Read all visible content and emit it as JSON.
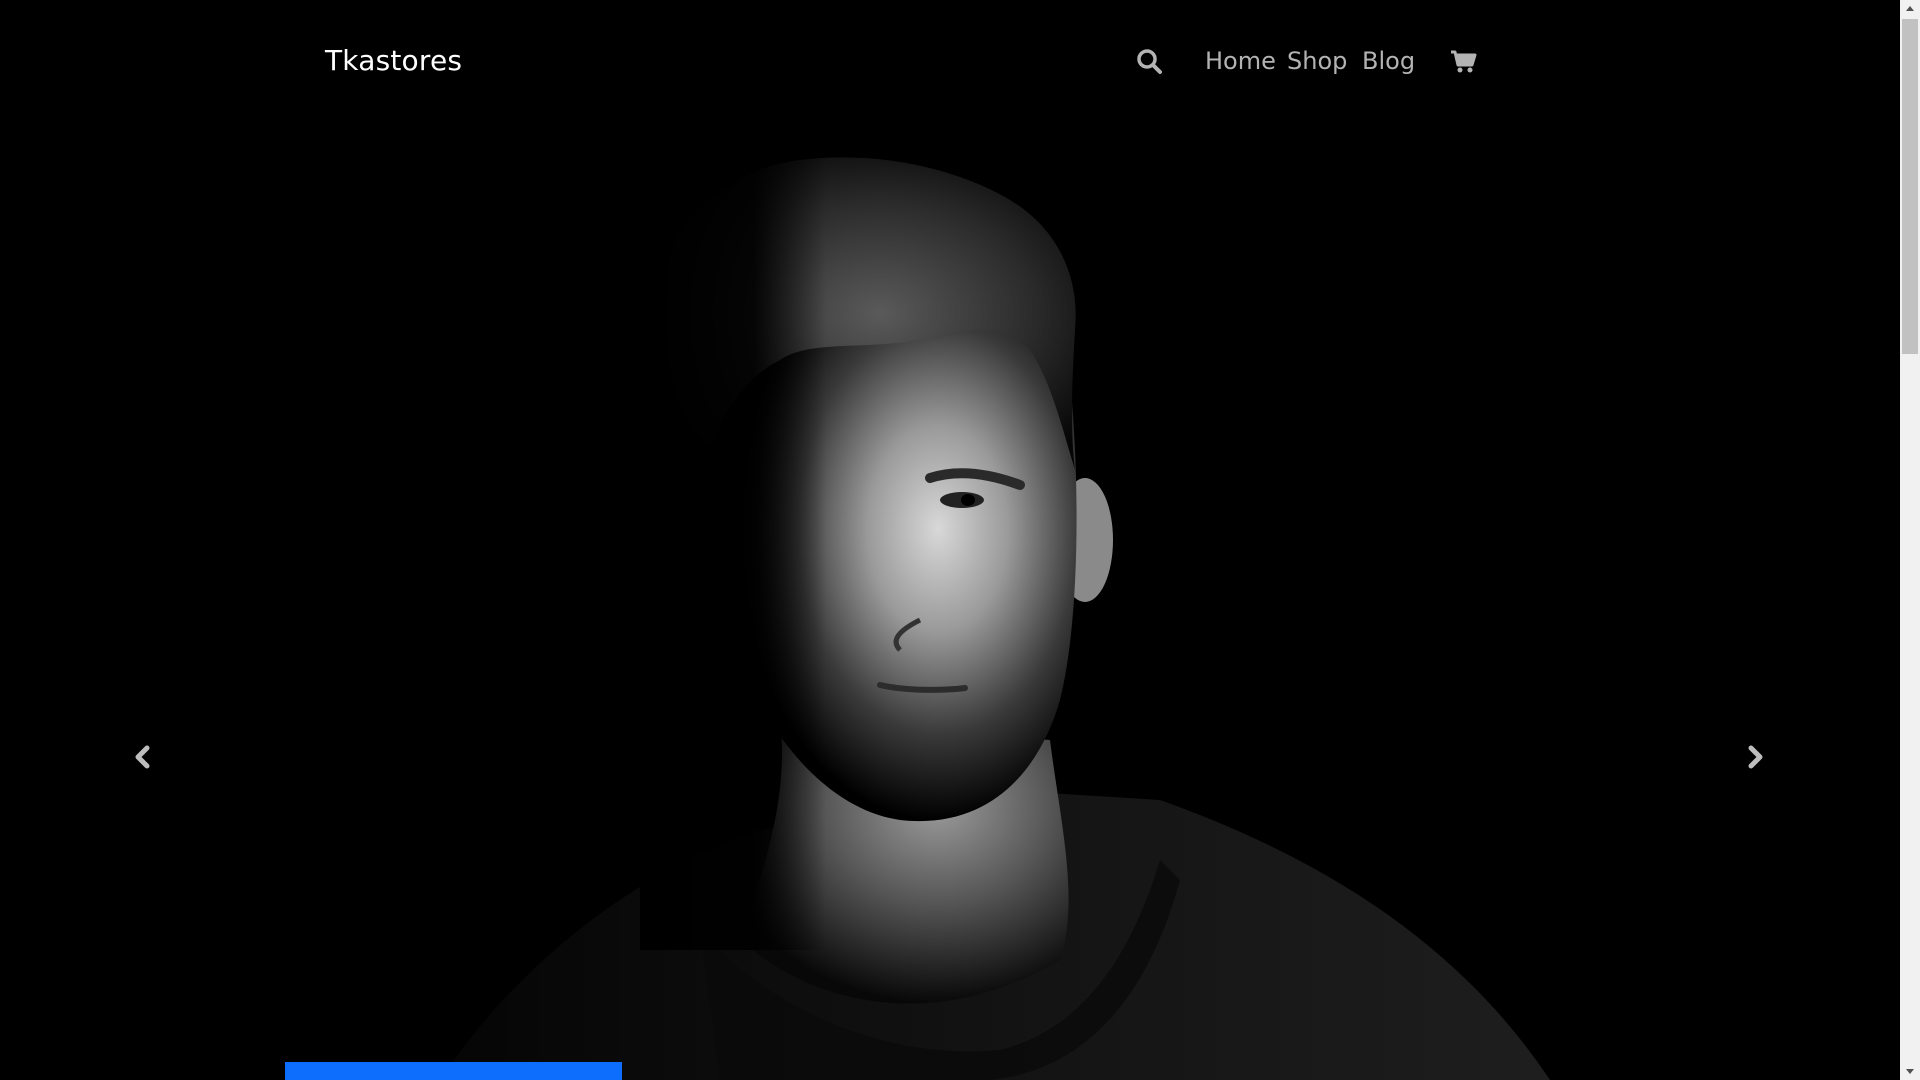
{
  "navbar": {
    "brand": "Tkastores",
    "links": [
      "Home",
      "Shop",
      "Blog"
    ],
    "search_icon": "search-icon",
    "cart_icon": "cart-icon"
  },
  "hero": {
    "image": "black-and-white portrait of a man in a dark t-shirt",
    "prev_icon": "chevron-left-icon",
    "next_icon": "chevron-right-icon"
  },
  "colors": {
    "background": "#000000",
    "brand_text": "#ffffff",
    "nav_text": "#b3b3b3",
    "accent": "#0d6efd"
  }
}
